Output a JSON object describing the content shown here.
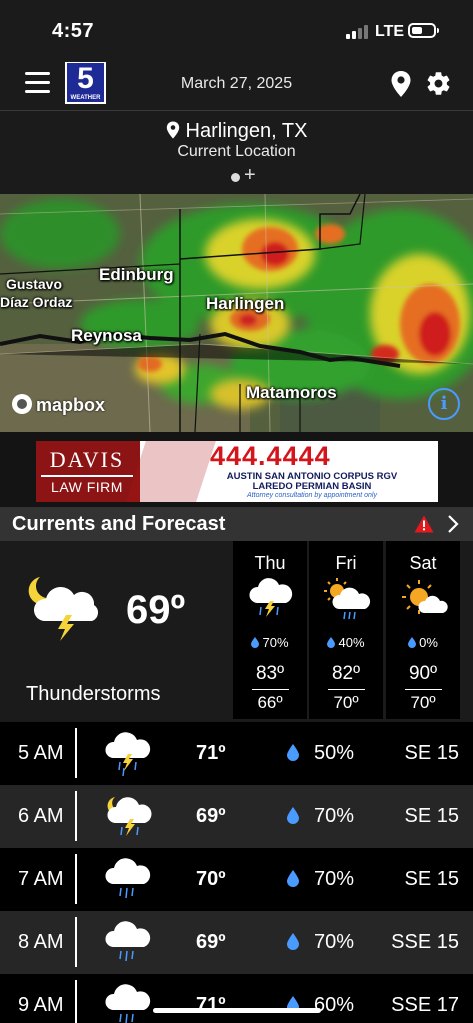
{
  "status_bar": {
    "time": "4:57",
    "network": "LTE"
  },
  "header": {
    "logo_number": "5",
    "logo_text": "WEATHER",
    "date": "March 27, 2025"
  },
  "location": {
    "city": "Harlingen, TX",
    "subtitle": "Current Location",
    "pager_plus": "+"
  },
  "map": {
    "labels": [
      "Gustavo",
      "Díaz Ordaz",
      "Edinburg",
      "Reynosa",
      "Harlingen",
      "Matamoros"
    ],
    "attribution": "mapbox",
    "info_glyph": "i"
  },
  "ad": {
    "firm_line1": "DAVIS",
    "firm_line2": "LAW FIRM",
    "phone": "444.4444",
    "cities_line1": "AUSTIN   SAN ANTONIO   CORPUS   RGV",
    "cities_line2": "LAREDO   PERMIAN BASIN",
    "disclaimer": "Attorney consultation by appointment only"
  },
  "forecast_section": {
    "title": "Currents and Forecast",
    "alert_icon": "warning-triangle-icon",
    "chevron_icon": "chevron-right-icon"
  },
  "current": {
    "temperature": "69º",
    "condition": "Thunderstorms",
    "icon": "partly-cloudy-night-thunderstorm-icon"
  },
  "daily": [
    {
      "day": "Thu",
      "precip": "70%",
      "high": "83º",
      "low": "66º",
      "icon": "thunderstorm-rain-icon"
    },
    {
      "day": "Fri",
      "precip": "40%",
      "high": "82º",
      "low": "70º",
      "icon": "sun-cloud-rain-icon"
    },
    {
      "day": "Sat",
      "precip": "0%",
      "high": "90º",
      "low": "70º",
      "icon": "partly-sunny-icon"
    }
  ],
  "hourly": [
    {
      "hour": "5 AM",
      "temp": "71º",
      "precip": "50%",
      "wind": "SE 15",
      "icon": "thunderstorm-rain-icon"
    },
    {
      "hour": "6 AM",
      "temp": "69º",
      "precip": "70%",
      "wind": "SE 15",
      "icon": "night-thunderstorm-icon"
    },
    {
      "hour": "7 AM",
      "temp": "70º",
      "precip": "70%",
      "wind": "SE 15",
      "icon": "rain-cloud-icon"
    },
    {
      "hour": "8 AM",
      "temp": "69º",
      "precip": "70%",
      "wind": "SSE 15",
      "icon": "rain-cloud-icon"
    },
    {
      "hour": "9 AM",
      "temp": "71º",
      "precip": "60%",
      "wind": "SSE 17",
      "icon": "rain-cloud-icon"
    }
  ],
  "colors": {
    "background": "#1b1b1b",
    "accent_blue": "#4a9bff",
    "alert_red": "#e4191f",
    "brand_blue": "#1e2a96",
    "ad_red": "#8d1414"
  }
}
